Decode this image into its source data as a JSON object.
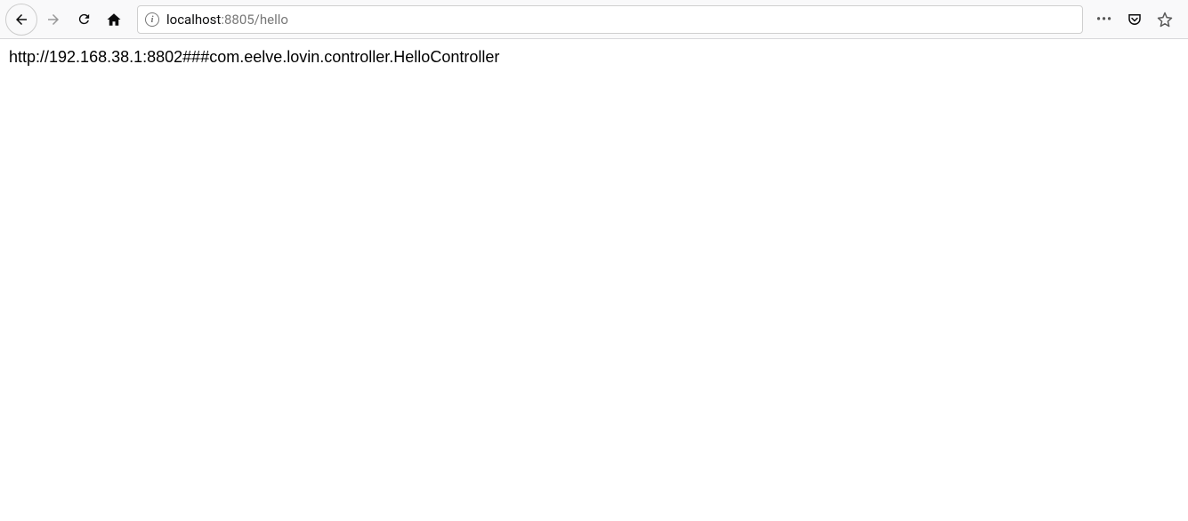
{
  "browser": {
    "url_host": "localhost",
    "url_path": ":8805/hello",
    "info_char": "i",
    "dots": "•••"
  },
  "page": {
    "body_text": "http://192.168.38.1:8802###com.eelve.lovin.controller.HelloController"
  }
}
